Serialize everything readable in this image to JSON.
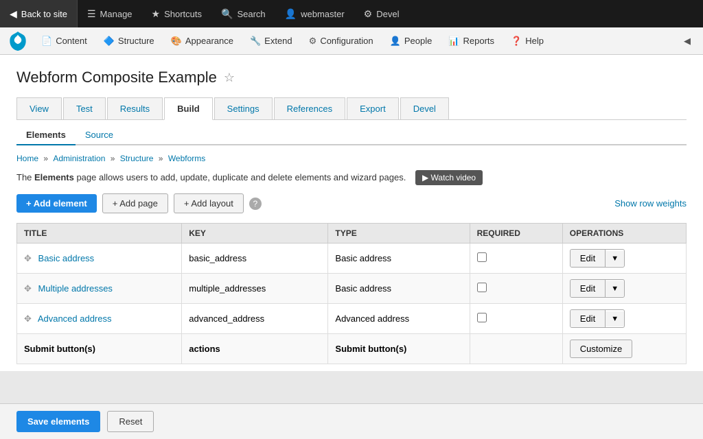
{
  "adminBar": {
    "backToSite": "Back to site",
    "manage": "Manage",
    "shortcuts": "Shortcuts",
    "search": "Search",
    "user": "webmaster",
    "devel": "Devel"
  },
  "secondaryNav": {
    "items": [
      {
        "id": "content",
        "label": "Content",
        "icon": "📄"
      },
      {
        "id": "structure",
        "label": "Structure",
        "icon": "🔷"
      },
      {
        "id": "appearance",
        "label": "Appearance",
        "icon": "🎨"
      },
      {
        "id": "extend",
        "label": "Extend",
        "icon": "🔧"
      },
      {
        "id": "configuration",
        "label": "Configuration",
        "icon": "⚙"
      },
      {
        "id": "people",
        "label": "People",
        "icon": "👤"
      },
      {
        "id": "reports",
        "label": "Reports",
        "icon": "📊"
      },
      {
        "id": "help",
        "label": "Help",
        "icon": "❓"
      }
    ]
  },
  "pageTitle": "Webform Composite Example",
  "primaryTabs": [
    {
      "id": "view",
      "label": "View"
    },
    {
      "id": "test",
      "label": "Test"
    },
    {
      "id": "results",
      "label": "Results"
    },
    {
      "id": "build",
      "label": "Build",
      "active": true
    },
    {
      "id": "settings",
      "label": "Settings"
    },
    {
      "id": "references",
      "label": "References"
    },
    {
      "id": "export",
      "label": "Export"
    },
    {
      "id": "devel",
      "label": "Devel"
    }
  ],
  "secondaryTabs": [
    {
      "id": "elements",
      "label": "Elements",
      "active": true
    },
    {
      "id": "source",
      "label": "Source"
    }
  ],
  "breadcrumb": [
    {
      "label": "Home",
      "href": "#"
    },
    {
      "label": "Administration",
      "href": "#"
    },
    {
      "label": "Structure",
      "href": "#"
    },
    {
      "label": "Webforms",
      "href": "#"
    }
  ],
  "description": {
    "before": "The ",
    "highlight": "Elements",
    "after": " page allows users to add, update, duplicate and delete elements and wizard pages."
  },
  "watchVideoBtn": "▶ Watch video",
  "actionButtons": {
    "addElement": "+ Add element",
    "addPage": "+ Add page",
    "addLayout": "+ Add layout",
    "showRowWeights": "Show row weights"
  },
  "tableHeaders": [
    "TITLE",
    "KEY",
    "TYPE",
    "REQUIRED",
    "OPERATIONS"
  ],
  "tableRows": [
    {
      "id": "basic-address",
      "title": "Basic address",
      "key": "basic_address",
      "type": "Basic address",
      "required": false,
      "operation": "Edit",
      "bold": false
    },
    {
      "id": "multiple-addresses",
      "title": "Multiple addresses",
      "key": "multiple_addresses",
      "type": "Basic address",
      "required": false,
      "operation": "Edit",
      "bold": false
    },
    {
      "id": "advanced-address",
      "title": "Advanced address",
      "key": "advanced_address",
      "type": "Advanced address",
      "required": false,
      "operation": "Edit",
      "bold": false
    },
    {
      "id": "submit-buttons",
      "title": "Submit button(s)",
      "key": "actions",
      "type": "Submit button(s)",
      "required": null,
      "operation": "Customize",
      "bold": true
    }
  ],
  "bottomButtons": {
    "save": "Save elements",
    "reset": "Reset"
  }
}
